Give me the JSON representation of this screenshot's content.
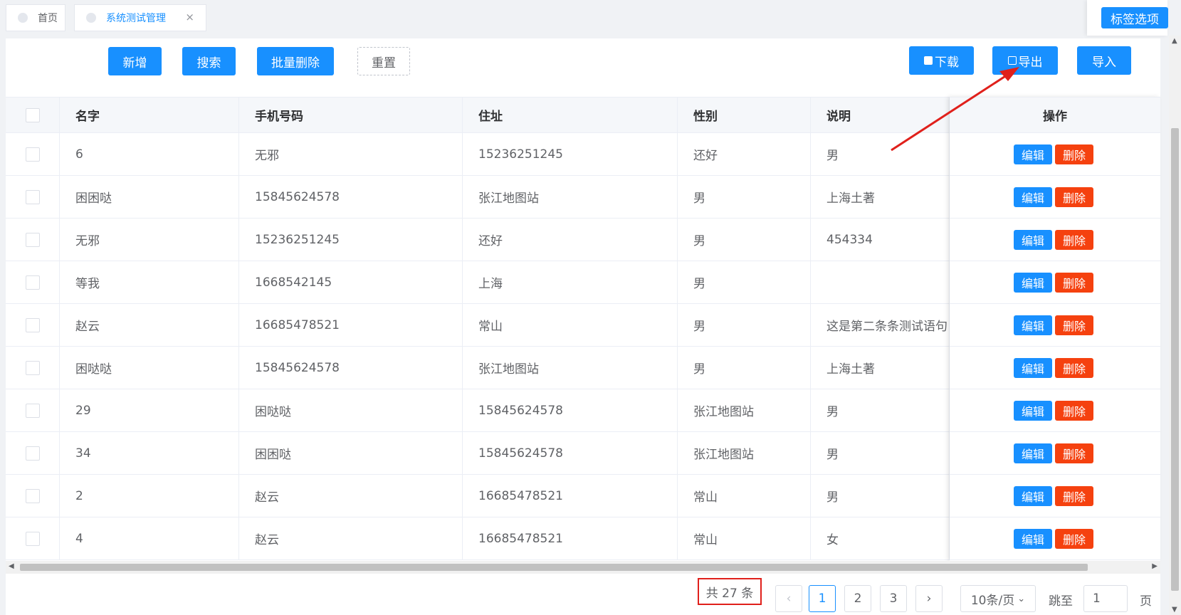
{
  "tabs": [
    {
      "label": "首页",
      "active": false
    },
    {
      "label": "系统测试管理",
      "active": true
    }
  ],
  "tab_close_glyph": "×",
  "tab_options_label": "标签选项",
  "toolbar": {
    "add": "新增",
    "search": "搜索",
    "batch_delete": "批量删除",
    "reset": "重置",
    "download": "下载",
    "export": "导出",
    "import": "导入"
  },
  "table": {
    "headers": [
      "名字",
      "手机号码",
      "住址",
      "性别",
      "说明",
      "操作"
    ],
    "rows": [
      [
        "6",
        "无邪",
        "15236251245",
        "还好",
        "男"
      ],
      [
        "困困哒",
        "15845624578",
        "张江地图站",
        "男",
        "上海土著"
      ],
      [
        "无邪",
        "15236251245",
        "还好",
        "男",
        "454334"
      ],
      [
        "等我",
        "1668542145",
        "上海",
        "男",
        ""
      ],
      [
        "赵云",
        "16685478521",
        "常山",
        "男",
        "这是第二条条测试语句"
      ],
      [
        "困哒哒",
        "15845624578",
        "张江地图站",
        "男",
        "上海土著"
      ],
      [
        "29",
        "困哒哒",
        "15845624578",
        "张江地图站",
        "男"
      ],
      [
        "34",
        "困困哒",
        "15845624578",
        "张江地图站",
        "男"
      ],
      [
        "2",
        "赵云",
        "16685478521",
        "常山",
        "男"
      ],
      [
        "4",
        "赵云",
        "16685478521",
        "常山",
        "女"
      ]
    ],
    "edit_label": "编辑",
    "delete_label": "删除"
  },
  "pagination": {
    "total": "共 27 条",
    "pages": [
      "1",
      "2",
      "3"
    ],
    "current": "1",
    "prev_glyph": "‹",
    "next_glyph": "›",
    "page_size": "10条/页",
    "page_size_caret": "⌄",
    "jump_label": "跳至",
    "jump_value": "1",
    "page_unit": "页"
  },
  "colors": {
    "primary": "#1890ff",
    "danger": "#f5410f",
    "annotation": "#e0201b"
  }
}
